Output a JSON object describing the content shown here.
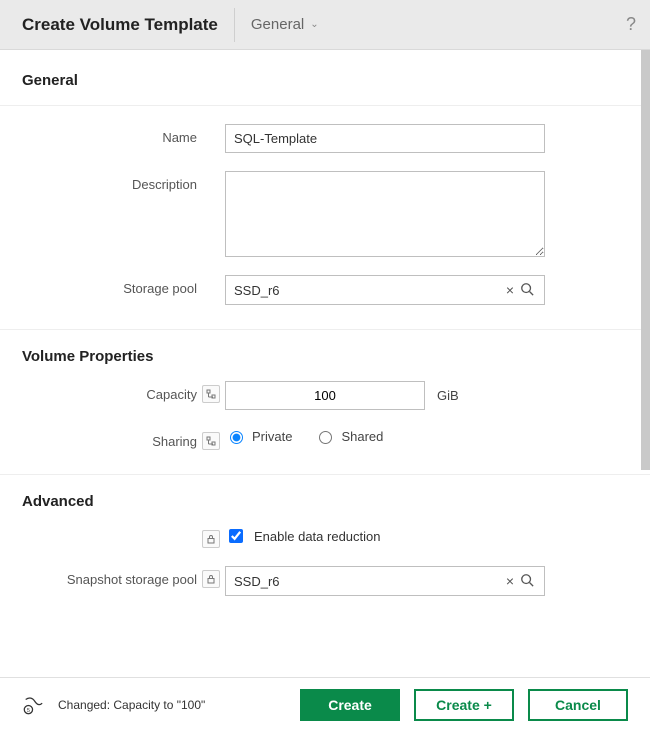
{
  "header": {
    "title": "Create Volume Template",
    "tab_label": "General",
    "help_icon": "?"
  },
  "sections": {
    "general": {
      "title": "General"
    },
    "volume_props": {
      "title": "Volume Properties"
    },
    "advanced": {
      "title": "Advanced"
    }
  },
  "fields": {
    "name": {
      "label": "Name",
      "value": "SQL-Template"
    },
    "description": {
      "label": "Description",
      "value": ""
    },
    "storage_pool": {
      "label": "Storage pool",
      "value": "SSD_r6"
    },
    "capacity": {
      "label": "Capacity",
      "value": "100",
      "unit": "GiB"
    },
    "sharing": {
      "label": "Sharing",
      "options": {
        "private": "Private",
        "shared": "Shared"
      },
      "selected": "private"
    },
    "enable_data_reduction": {
      "label": "Enable data reduction",
      "checked": true
    },
    "snapshot_storage_pool": {
      "label": "Snapshot storage pool",
      "value": "SSD_r6"
    }
  },
  "icons": {
    "clear": "×",
    "search": "🔍",
    "tree": "⎄",
    "lock": "🔒"
  },
  "footer": {
    "status": "Changed: Capacity to \"100\"",
    "create": "Create",
    "create_plus": "Create +",
    "cancel": "Cancel"
  }
}
